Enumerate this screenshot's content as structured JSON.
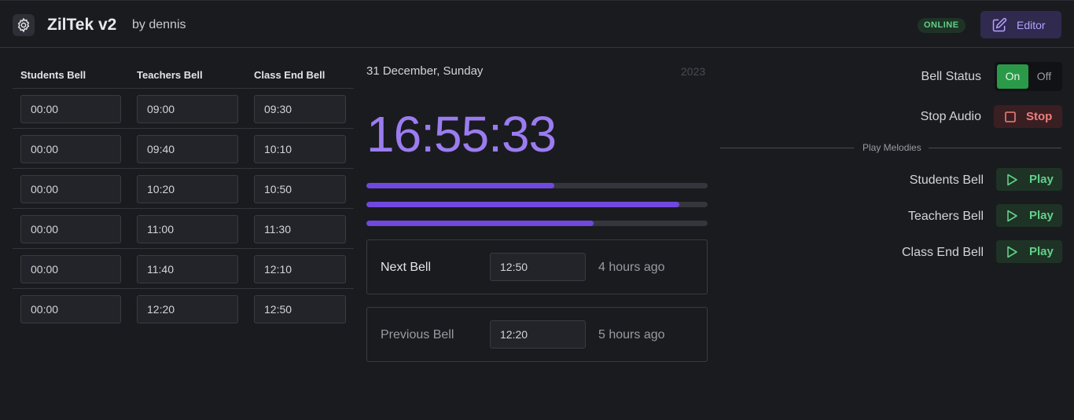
{
  "header": {
    "title": "ZilTek v2",
    "author": "by dennis",
    "status_badge": "ONLINE",
    "editor_label": "Editor"
  },
  "schedule": {
    "columns": [
      "Students Bell",
      "Teachers Bell",
      "Class End Bell"
    ],
    "rows": [
      [
        "00:00",
        "09:00",
        "09:30"
      ],
      [
        "00:00",
        "09:40",
        "10:10"
      ],
      [
        "00:00",
        "10:20",
        "10:50"
      ],
      [
        "00:00",
        "11:00",
        "11:30"
      ],
      [
        "00:00",
        "11:40",
        "12:10"
      ],
      [
        "00:00",
        "12:20",
        "12:50"
      ]
    ]
  },
  "clock": {
    "date": "31 December, Sunday",
    "year": "2023",
    "time": "16:55:33",
    "progress": [
      0.55,
      0.917,
      0.667
    ]
  },
  "next_bell": {
    "label": "Next Bell",
    "time": "12:50",
    "relative": "4 hours ago"
  },
  "previous_bell": {
    "label": "Previous Bell",
    "time": "12:20",
    "relative": "5 hours ago"
  },
  "controls": {
    "bell_status_label": "Bell Status",
    "toggle_on": "On",
    "toggle_off": "Off",
    "toggle_state": "on",
    "stop_audio_label": "Stop Audio",
    "stop_button": "Stop",
    "melodies_divider": "Play Melodies",
    "melodies": [
      {
        "label": "Students Bell",
        "button": "Play"
      },
      {
        "label": "Teachers Bell",
        "button": "Play"
      },
      {
        "label": "Class End Bell",
        "button": "Play"
      }
    ]
  },
  "colors": {
    "accent": "#7048e0",
    "clock": "#9b7cf0",
    "online": "#62d08a",
    "stop": "#ef7e7e"
  }
}
